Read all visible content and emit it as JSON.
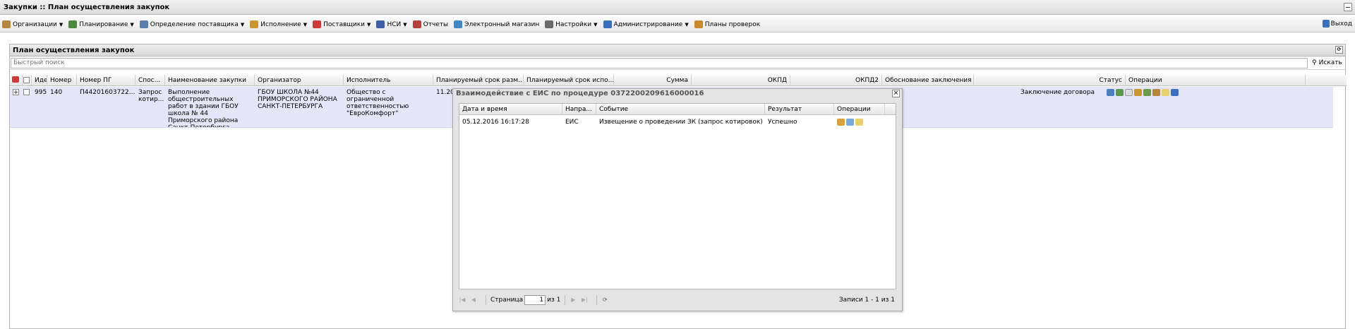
{
  "window": {
    "title": "Закупки :: План осуществления закупок"
  },
  "menu": {
    "items": [
      {
        "label": "Организации",
        "icon": "building-icon",
        "color": "#b8863b",
        "has_arrow": true
      },
      {
        "label": "Планирование",
        "icon": "grid-icon",
        "color": "#4a8a3a",
        "has_arrow": true
      },
      {
        "label": "Определение поставщика",
        "icon": "people-icon",
        "color": "#5a7fa8",
        "has_arrow": true
      },
      {
        "label": "Исполнение",
        "icon": "hammer-icon",
        "color": "#c9952f",
        "has_arrow": true
      },
      {
        "label": "Поставщики",
        "icon": "clock-icon",
        "color": "#cc3a3a",
        "has_arrow": true
      },
      {
        "label": "НСИ",
        "icon": "book-icon",
        "color": "#3d5fa8",
        "has_arrow": true
      },
      {
        "label": "Отчеты",
        "icon": "report-icon",
        "color": "#b54040",
        "has_arrow": false
      },
      {
        "label": "Электронный магазин",
        "icon": "cart-icon",
        "color": "#3f86c9",
        "has_arrow": false
      },
      {
        "label": "Настройки",
        "icon": "wrench-icon",
        "color": "#6a6a6a",
        "has_arrow": true
      },
      {
        "label": "Администрирование",
        "icon": "user-icon",
        "color": "#3a6fbf",
        "has_arrow": true
      },
      {
        "label": "Планы проверок",
        "icon": "user-check-icon",
        "color": "#c98a2f",
        "has_arrow": false
      }
    ],
    "exit_label": "Выход"
  },
  "panel": {
    "title": "План осуществления закупок",
    "search_placeholder": "Быстрый поиск",
    "search_button": "Искать"
  },
  "grid": {
    "columns": [
      "Иде",
      "Номер",
      "Номер ПГ",
      "Спос...",
      "Наименование закупки",
      "Организатор",
      "Исполнитель",
      "Планируемый срок разм...",
      "Планируемый срок испо...",
      "Сумма",
      "ОКПД",
      "ОКПД2",
      "Обоснование заключения",
      "Статус",
      "Операции"
    ],
    "rows": [
      {
        "id": "995",
        "number": "140",
        "pg_number": "П44201603722...",
        "method": "Запрос котир...",
        "name": "Выполнение общестроительных работ в здании ГБОУ школа № 44 Приморского района Санкт-Петербурга",
        "organizer": "ГБОУ ШКОЛА №44 ПРИМОРСКОГО РАЙОНА САНКТ-ПЕТЕРБУРГА",
        "executor": "Общество с ограниченной ответственностью \"ЕвроКомфорт\"",
        "planned_date": "11.20",
        "status": "Заключение договора"
      }
    ]
  },
  "modal": {
    "title": "Взаимодействие с ЕИС по процедуре 0372200209616000016",
    "columns": [
      "Дата и время",
      "Напра...",
      "Событие",
      "Результат",
      "Операции"
    ],
    "rows": [
      {
        "datetime": "05.12.2016 16:17:28",
        "direction": "ЕИС",
        "event": "Извещение о проведении ЗК (запрос котировок)",
        "result": "Успешно"
      }
    ],
    "paging": {
      "page_label": "Страница",
      "page_value": "1",
      "of_label": "из 1",
      "records_info": "Записи 1 - 1 из 1"
    }
  }
}
